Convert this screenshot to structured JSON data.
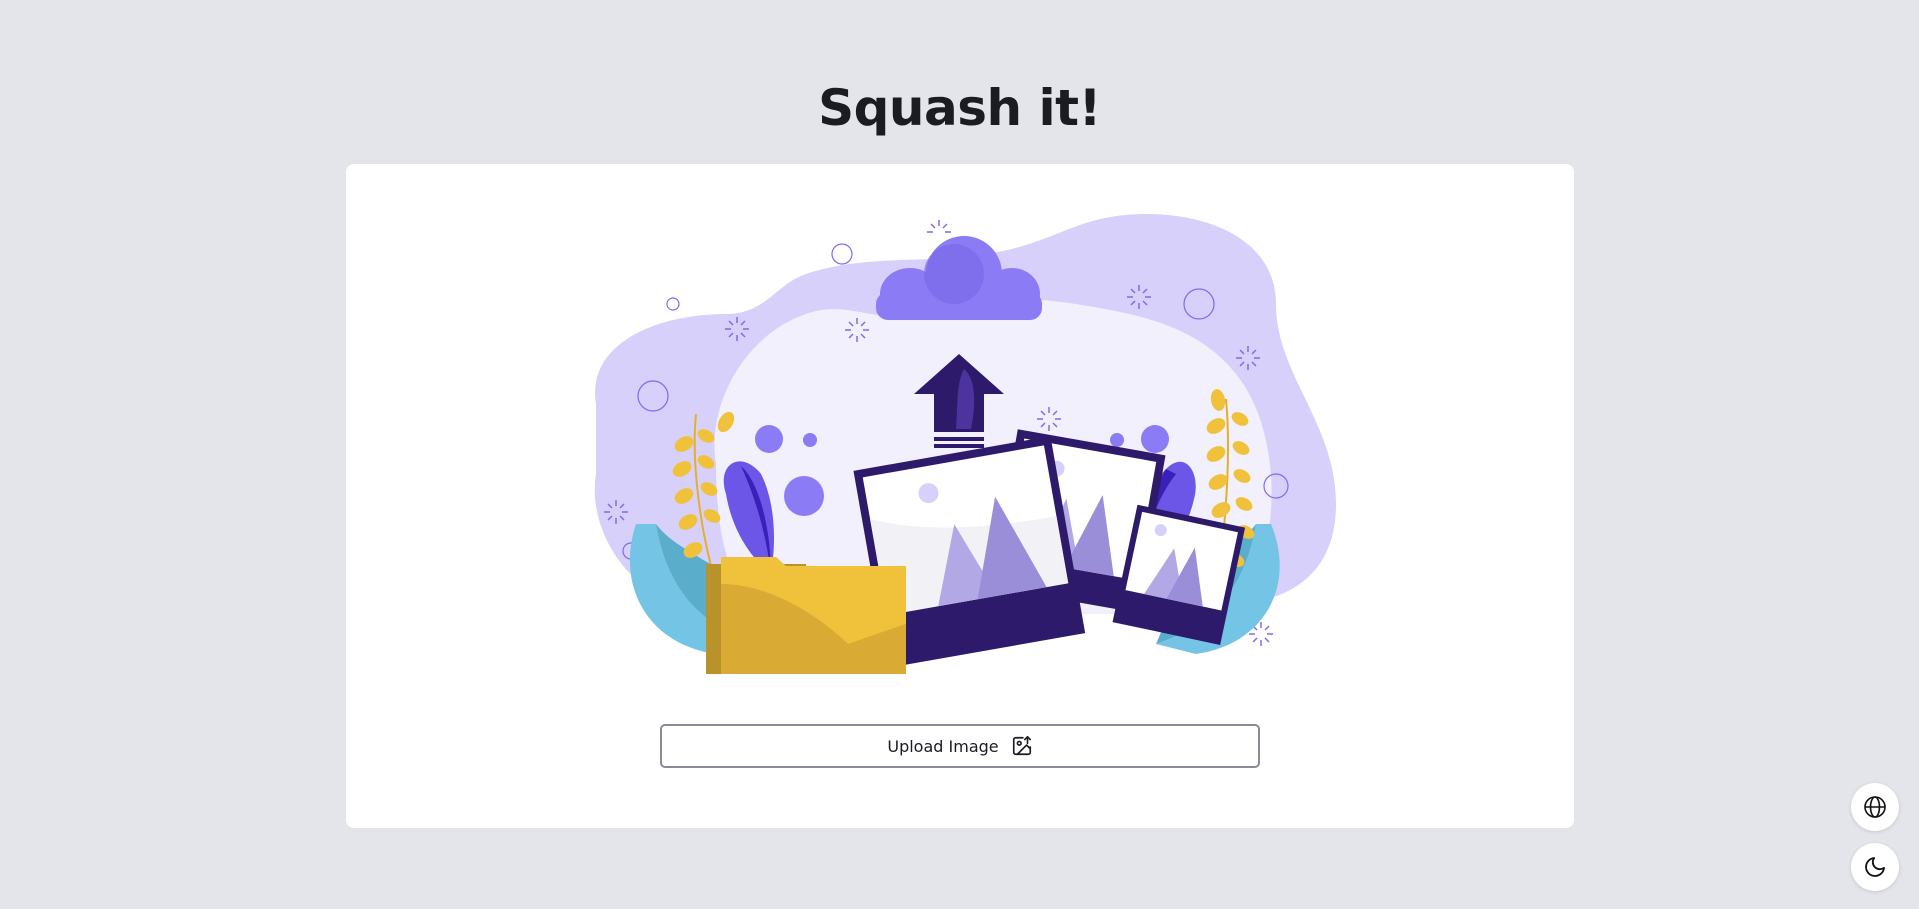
{
  "header": {
    "title": "Squash it!"
  },
  "upload": {
    "button_label": "Upload Image",
    "icon": "image-upload-icon",
    "illustration": "upload-illustration"
  },
  "floating_actions": {
    "language_icon": "globe-icon",
    "theme_icon": "moon-icon"
  },
  "colors": {
    "background": "#e4e5ea",
    "card": "#ffffff",
    "title": "#1b1b22",
    "accent_purple": "#8b7cf6",
    "dark_purple": "#2e1a6b",
    "folder_yellow": "#f0c23b",
    "leaf_blue": "#74c4e6"
  }
}
